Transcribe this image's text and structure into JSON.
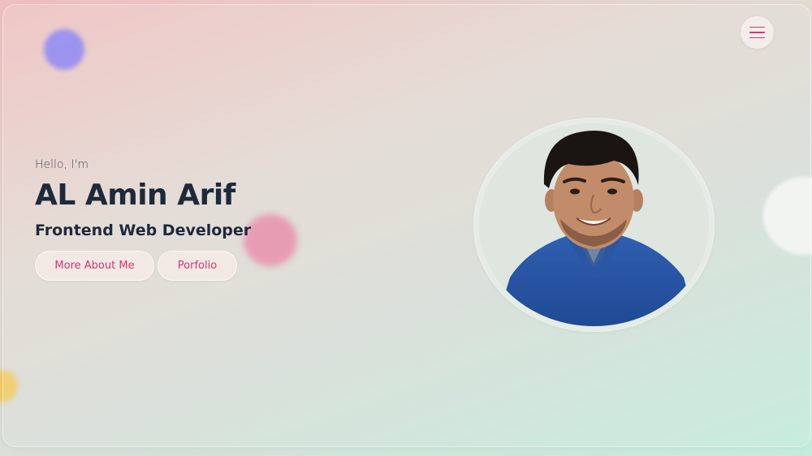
{
  "menu": {
    "icon": "hamburger-menu-icon"
  },
  "hero": {
    "greeting": "Hello, I'm",
    "name": "AL Amin Arif",
    "role": "Frontend Web Developer"
  },
  "buttons": {
    "about_label": "More About Me",
    "portfolio_label": "Porfolio"
  },
  "portrait": {
    "alt": "Profile photo of AL Amin Arif"
  },
  "colors": {
    "accent": "#d0386e",
    "heading": "#1d2a3c",
    "blob_purple": "#8f86ec",
    "blob_pink": "#e593ad",
    "blob_yellow": "#f0cb6a"
  }
}
